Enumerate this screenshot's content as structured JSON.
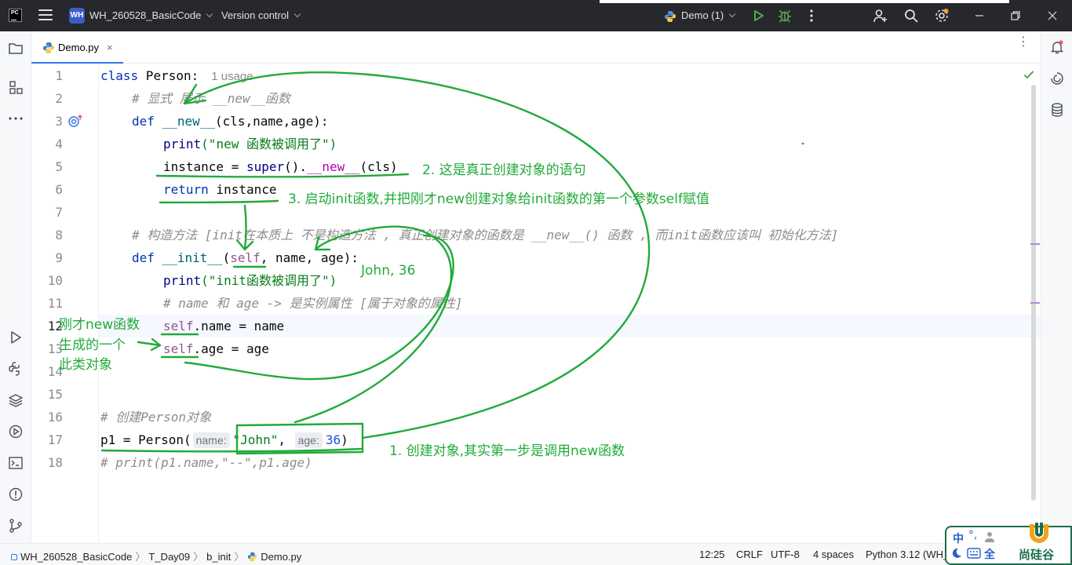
{
  "titlebar": {
    "logo": "PC",
    "project_badge": "WH",
    "project_name": "WH_260528_BasicCode",
    "vcs_label": "Version control",
    "run_config": "Demo (1)"
  },
  "tabs": [
    {
      "label": "Demo.py",
      "close": "×"
    }
  ],
  "code": {
    "lines": [
      {
        "n": "1"
      },
      {
        "n": "2"
      },
      {
        "n": "3"
      },
      {
        "n": "4"
      },
      {
        "n": "5"
      },
      {
        "n": "6"
      },
      {
        "n": "7"
      },
      {
        "n": "8"
      },
      {
        "n": "9"
      },
      {
        "n": "10"
      },
      {
        "n": "11"
      },
      {
        "n": "12"
      },
      {
        "n": "13"
      },
      {
        "n": "14"
      },
      {
        "n": "15"
      },
      {
        "n": "16"
      },
      {
        "n": "17"
      },
      {
        "n": "18"
      }
    ],
    "l1_class_kw": "class",
    "l1_name": " Person:",
    "l1_usage": "1 usage",
    "l2": "# 显式 展示 __new__函数",
    "l3_def": "def",
    "l3_fn": "__new__",
    "l3_rest": "(cls,name,age):",
    "l4_print": "print",
    "l4_str": "(\"new 函数被调用了\")",
    "l5_a": "instance = ",
    "l5_super": "super",
    "l5_b": "().",
    "l5_new": "__new__",
    "l5_c": "(cls)",
    "l6_ret": "return",
    "l6_b": " instance",
    "l8": "# 构造方法 [init在本质上 不是构造方法 , 真正创建对象的函数是 __new__() 函数 , 而init函数应该叫 初始化方法]",
    "l9_def": "def",
    "l9_fn": "__init__",
    "l9_a": "(",
    "l9_self": "self",
    "l9_b": ", name, age):",
    "l10_print": "print",
    "l10_str": "(\"init函数被调用了\")",
    "l11": "# name 和 age -> 是实例属性 [属于对象的属性]",
    "l12_self": "self",
    "l12_b": ".name = name",
    "l13_self": "self",
    "l13_b": ".age = age",
    "l16": "# 创建Person对象",
    "l17_a": "p1 = ",
    "l17_cls": "Person",
    "l17_b": "(",
    "l17_hint1": "name:",
    "l17_str": "\"John\"",
    "l17_c": ", ",
    "l17_hint2": "age:",
    "l17_num": "36",
    "l17_d": ")",
    "l18": "# print(p1.name,\"--\",p1.age)"
  },
  "annotations": {
    "a1": "1. 创建对象,其实第一步是调用new函数",
    "a2": "2. 这是真正创建对象的语句",
    "a3": "3. 启动init函数,并把刚才new创建对象给init函数的第一个参数self赋值",
    "john": "John, 36",
    "side1": "刚才new函数",
    "side2": "生成的一个",
    "side3": "此类对象"
  },
  "statusbar": {
    "crumbs": [
      "WH_260528_BasicCode",
      "T_Day09",
      "b_init",
      "Demo.py"
    ],
    "position": "12:25",
    "line_sep": "CRLF",
    "encoding": "UTF-8",
    "indent": "4 spaces",
    "interpreter": "Python 3.12 (WH_"
  },
  "ime_widget": {
    "mode": "中",
    "punct": "°,",
    "full": "全",
    "brand": "尚硅谷"
  },
  "colors": {
    "annotation_green": "#22aa3b",
    "titlebar_bg": "#27282c",
    "accent": "#3574f0"
  }
}
